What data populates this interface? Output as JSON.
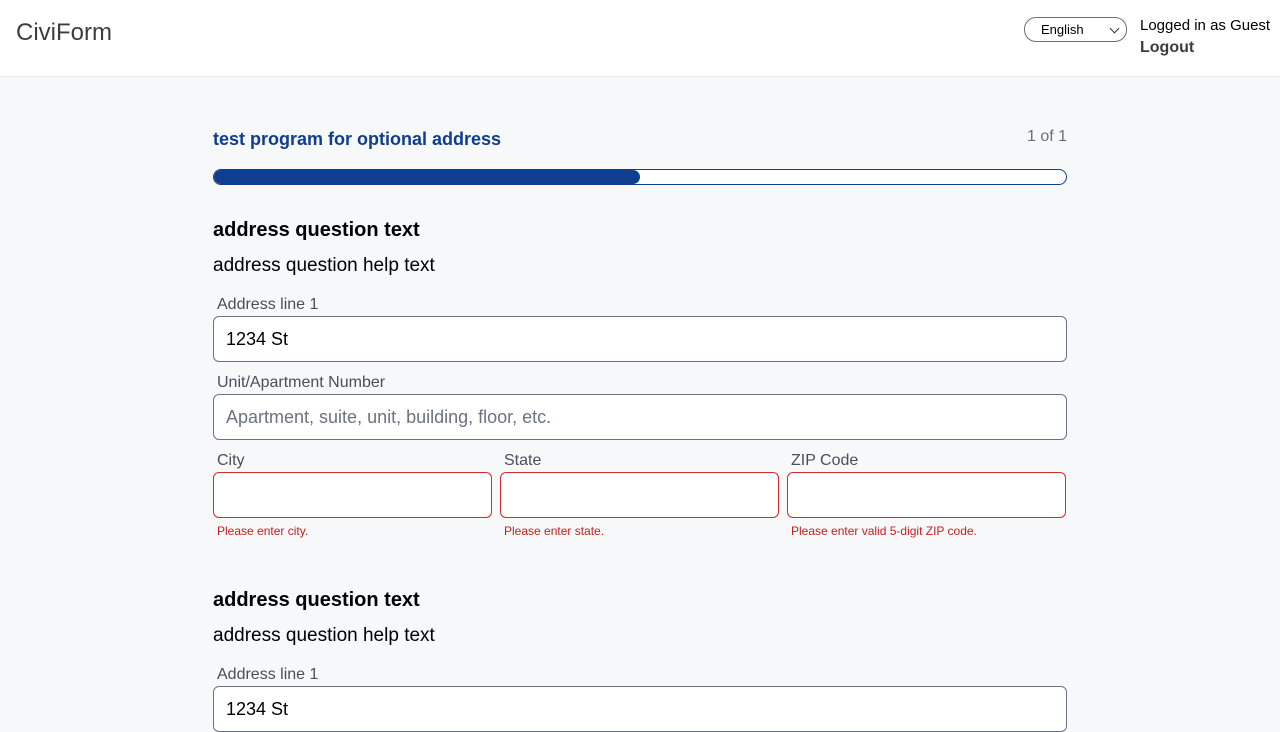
{
  "header": {
    "brand": "CiviForm",
    "language": "English",
    "login_status": "Logged in as Guest",
    "logout": "Logout"
  },
  "program": {
    "title": "test program for optional address",
    "step": "1 of 1",
    "progress_fraction": 0.5
  },
  "questions": [
    {
      "title": "address question text",
      "help": "address question help text",
      "address_line_1": {
        "label": "Address line 1",
        "value": "1234 St"
      },
      "unit": {
        "label": "Unit/Apartment Number",
        "placeholder": "Apartment, suite, unit, building, floor, etc."
      },
      "city": {
        "label": "City",
        "value": "",
        "error": "Please enter city."
      },
      "state": {
        "label": "State",
        "value": "",
        "error": "Please enter state."
      },
      "zip": {
        "label": "ZIP Code",
        "value": "",
        "error": "Please enter valid 5-digit ZIP code."
      }
    },
    {
      "title": "address question text",
      "help": "address question help text",
      "address_line_1": {
        "label": "Address line 1",
        "value": "1234 St"
      }
    }
  ]
}
